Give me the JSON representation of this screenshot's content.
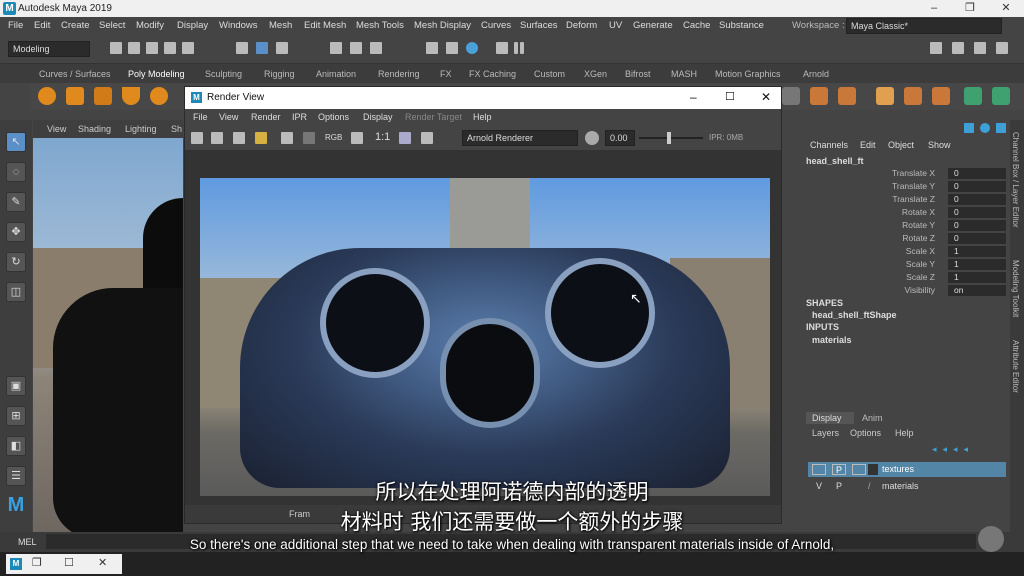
{
  "app": {
    "title": "Autodesk Maya 2019",
    "logo_letter": "M"
  },
  "window_controls": {
    "minimize": "–",
    "maximize": "❐",
    "close": "✕"
  },
  "menubar": [
    "File",
    "Edit",
    "Create",
    "Select",
    "Modify",
    "Display",
    "Windows",
    "Mesh",
    "Edit Mesh",
    "Mesh Tools",
    "Mesh Display",
    "Curves",
    "Surfaces",
    "Deform",
    "UV",
    "Generate",
    "Cache",
    "Substance"
  ],
  "workspace": {
    "label": "Workspace :",
    "value": "Maya Classic*"
  },
  "toolbar": {
    "mode": "Modeling"
  },
  "shelf_tabs": [
    "Curves / Surfaces",
    "Poly Modeling",
    "Sculpting",
    "Rigging",
    "Animation",
    "Rendering",
    "FX",
    "FX Caching",
    "Custom",
    "XGen",
    "Bifrost",
    "MASH",
    "Motion Graphics",
    "Arnold"
  ],
  "shelf_active": "Poly Modeling",
  "viewport_menu": [
    "View",
    "Shading",
    "Lighting",
    "Sh"
  ],
  "render_view": {
    "title": "Render View",
    "menu": [
      "File",
      "View",
      "Render",
      "IPR",
      "Options",
      "Display",
      "Render Target",
      "Help"
    ],
    "ratio": "1:1",
    "rgb": "RGB",
    "renderer": "Arnold Renderer",
    "exposure": "0.00",
    "ipr": "IPR: 0MB",
    "frame_label": "Fram"
  },
  "channel_box": {
    "menu": [
      "Channels",
      "Edit",
      "Object",
      "Show"
    ],
    "object": "head_shell_ft",
    "attributes": [
      {
        "label": "Translate X",
        "value": "0"
      },
      {
        "label": "Translate Y",
        "value": "0"
      },
      {
        "label": "Translate Z",
        "value": "0"
      },
      {
        "label": "Rotate X",
        "value": "0"
      },
      {
        "label": "Rotate Y",
        "value": "0"
      },
      {
        "label": "Rotate Z",
        "value": "0"
      },
      {
        "label": "Scale X",
        "value": "1"
      },
      {
        "label": "Scale Y",
        "value": "1"
      },
      {
        "label": "Scale Z",
        "value": "1"
      },
      {
        "label": "Visibility",
        "value": "on"
      }
    ],
    "shapes_header": "SHAPES",
    "shape": "head_shell_ftShape",
    "inputs_header": "INPUTS",
    "input": "materials"
  },
  "layer_editor": {
    "tabs": [
      "Display",
      "Anim"
    ],
    "menu": [
      "Layers",
      "Options",
      "Help"
    ],
    "layers": [
      {
        "v": "",
        "p": "P",
        "name": "textures",
        "selected": true
      },
      {
        "v": "V",
        "p": "P",
        "name": "materials",
        "selected": false
      }
    ]
  },
  "side_tabs": [
    "Channel Box / Layer Editor",
    "Modeling Toolkit",
    "Attribute Editor"
  ],
  "mel": {
    "label": "MEL"
  },
  "subtitles": {
    "cn_line1": "所以在处理阿诺德内部的透明",
    "cn_line2": "材料时 我们还需要做一个额外的步骤",
    "en": "So there's one additional step that we need to take when dealing with transparent materials inside of Arnold,"
  }
}
